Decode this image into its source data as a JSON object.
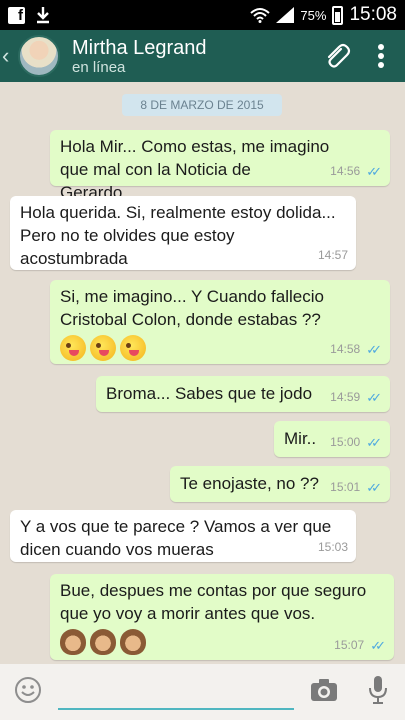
{
  "status_bar": {
    "left_icons": [
      "facebook-icon",
      "download-icon"
    ],
    "battery": "75%",
    "time": "15:08"
  },
  "header": {
    "back_glyph": "‹",
    "contact_name": "Mirtha Legrand",
    "contact_status": "en línea"
  },
  "chat": {
    "date_chip": "8 DE MARZO DE 2015",
    "messages": [
      {
        "direction": "out",
        "text": "Hola Mir... Como estas, me imagino que mal con la Noticia de Gerardo...",
        "time": "14:56",
        "read": true
      },
      {
        "direction": "in",
        "text": "Hola querida. Si, realmente estoy dolida... Pero no te olvides que estoy acostumbrada",
        "time": "14:57"
      },
      {
        "direction": "out",
        "text": "Si, me imagino... Y Cuando fallecio Cristobal Colon, donde estabas ??",
        "emojis": [
          "wink-tongue",
          "wink-tongue",
          "wink-tongue"
        ],
        "time": "14:58",
        "read": true
      },
      {
        "direction": "out",
        "text": "Broma... Sabes que te jodo",
        "time": "14:59",
        "read": true
      },
      {
        "direction": "out",
        "text": "Mir..",
        "time": "15:00",
        "read": true
      },
      {
        "direction": "out",
        "text": "Te enojaste, no ??",
        "time": "15:01",
        "read": true
      },
      {
        "direction": "in",
        "text": "Y a vos que te parece ? Vamos a ver que dicen cuando vos mueras",
        "time": "15:03"
      },
      {
        "direction": "out",
        "text": "Bue, despues me contas por que seguro que yo voy a morir antes que vos.",
        "emojis": [
          "see-no-evil-monkey",
          "see-no-evil-monkey",
          "see-no-evil-monkey"
        ],
        "time": "15:07",
        "read": true
      }
    ]
  },
  "input": {
    "value": "",
    "placeholder": ""
  },
  "colors": {
    "header": "#1f5d53",
    "outgoing_bubble": "#e2fcc8",
    "incoming_bubble": "#ffffff",
    "read_check": "#4fa9e0",
    "chat_background": "#e4ddd3"
  }
}
